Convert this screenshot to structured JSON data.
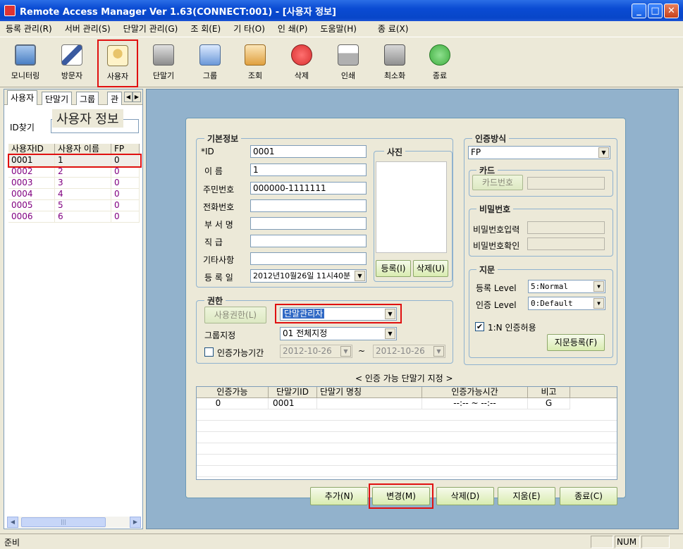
{
  "window": {
    "title": "Remote Access Manager Ver 1.63(CONNECT:001) - [사용자 정보]",
    "minimize": "_",
    "maximize": "□",
    "close": "✕"
  },
  "menu": [
    "등록 관리(R)",
    "서버 관리(S)",
    "단말기 관리(G)",
    "조 회(E)",
    "기 타(O)",
    "인 쇄(P)",
    "도움말(H)",
    "종 료(X)"
  ],
  "toolbar": [
    {
      "label": "모니터링",
      "icon": "monitor-icon",
      "color": "#4a7fc4"
    },
    {
      "label": "방문자",
      "icon": "visitor-pen-icon",
      "color": "#3a5aa0"
    },
    {
      "label": "사용자",
      "icon": "user-card-icon",
      "color": "#e8c46a"
    },
    {
      "label": "단말기",
      "icon": "terminal-device-icon",
      "color": "#8c8c8c"
    },
    {
      "label": "그룹",
      "icon": "group-computer-icon",
      "color": "#6b98d8"
    },
    {
      "label": "조회",
      "icon": "book-search-icon",
      "color": "#e0a040"
    },
    {
      "label": "삭제",
      "icon": "delete-stop-icon",
      "color": "#d83030"
    },
    {
      "label": "인쇄",
      "icon": "printer-icon",
      "color": "#b0b0b0"
    },
    {
      "label": "최소화",
      "icon": "minimize-window-icon",
      "color": "#909090"
    },
    {
      "label": "종료",
      "icon": "exit-arrow-icon",
      "color": "#3fae3f"
    }
  ],
  "left_panel": {
    "tabs": [
      "사용자",
      "단말기",
      "그룹",
      "관"
    ],
    "search_label": "ID찾기",
    "search_value": "",
    "columns": [
      "사용자ID",
      "사용자 이름",
      "FP"
    ],
    "rows": [
      {
        "id": "0001",
        "name": "1",
        "fp": "0"
      },
      {
        "id": "0002",
        "name": "2",
        "fp": "0"
      },
      {
        "id": "0003",
        "name": "3",
        "fp": "0"
      },
      {
        "id": "0004",
        "name": "4",
        "fp": "0"
      },
      {
        "id": "0005",
        "name": "5",
        "fp": "0"
      },
      {
        "id": "0006",
        "name": "6",
        "fp": "0"
      }
    ]
  },
  "form": {
    "title": "사용자 정보",
    "basic": {
      "title": "기본정보",
      "id_label": "*ID",
      "id_value": "0001",
      "name_label": "이    름",
      "name_value": "1",
      "rrn_label": "주민번호",
      "rrn_value": "000000-1111111",
      "phone_label": "전화번호",
      "phone_value": "",
      "dept_label": "부 서 명",
      "dept_value": "",
      "position_label": "직    급",
      "position_value": "",
      "etc_label": "기타사항",
      "etc_value": "",
      "regdate_label": "등 록 일",
      "regdate_value": "2012년10월26일 11시40분"
    },
    "photo": {
      "title": "사진",
      "register": "등록(I)",
      "delete": "삭제(U)"
    },
    "auth": {
      "title": "인증방식",
      "method_value": "FP",
      "card_title": "카드",
      "card_button": "카드번호",
      "card_value": "",
      "password_title": "비밀번호",
      "password_input_label": "비밀번호입력",
      "password_confirm_label": "비밀번호확인",
      "fingerprint_title": "지문",
      "reg_level_label": "등록 Level",
      "reg_level_value": "5:Normal",
      "auth_level_label": "인증 Level",
      "auth_level_value": "0:Default",
      "one_to_n_label": "1:N 인증허용",
      "one_to_n_checked": "✔",
      "fingerprint_register": "지문등록(F)"
    },
    "permission": {
      "title": "권한",
      "user_perm_button": "사용권한(L)",
      "role_value": "단말관리자",
      "group_label": "그룹지정",
      "group_value": "01 전체지정",
      "period_label": "인증가능기간",
      "period_start": "2012-10-26",
      "period_sep": "~",
      "period_end": "2012-10-26"
    },
    "terminal_caption": "< 인증 가능 단말기 지정 >",
    "terminal_table": {
      "columns": [
        "인증가능",
        "단말기ID",
        "단말기 명칭",
        "인증가능시간",
        "비고"
      ],
      "rows": [
        {
          "auth": "0",
          "terminal_id": "0001",
          "name": "",
          "time": "--:-- ~ --:--",
          "note": "G"
        }
      ]
    },
    "buttons": {
      "add": "추가(N)",
      "change": "변경(M)",
      "delete": "삭제(D)",
      "clear": "지움(E)",
      "close": "종료(C)"
    }
  },
  "status": {
    "text": "준비",
    "num": "NUM"
  }
}
